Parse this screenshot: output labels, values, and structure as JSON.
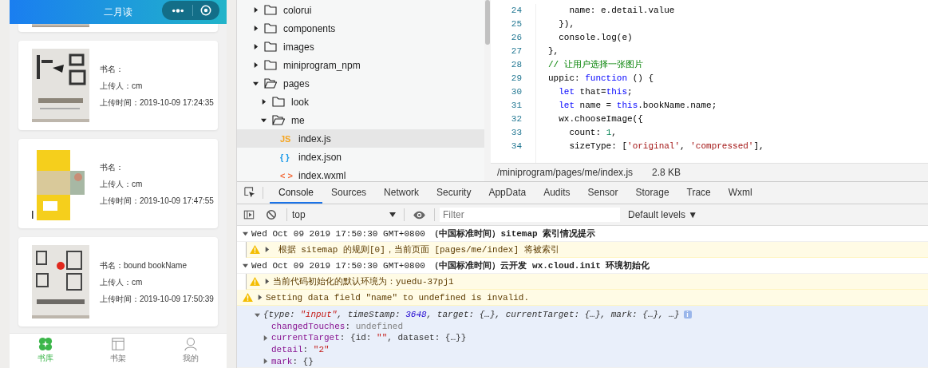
{
  "phone": {
    "title": "二月读",
    "books": [
      {
        "lines": [
          "书名：",
          "上传人：cm",
          "上传时间：2019-10-09 17:24:35"
        ]
      },
      {
        "lines": [
          "书名：",
          "上传人：cm",
          "上传时间：2019-10-09 17:47:55"
        ]
      },
      {
        "lines": [
          "书名：bound bookName",
          "上传人：cm",
          "上传时间：2019-10-09 17:50:39"
        ]
      }
    ],
    "tabbar": [
      {
        "label": "书库",
        "selected": true
      },
      {
        "label": "书架",
        "selected": false
      },
      {
        "label": "我的",
        "selected": false
      }
    ]
  },
  "tree": [
    {
      "name": "colorui",
      "kind": "folder",
      "expanded": false,
      "selected": false
    },
    {
      "name": "components",
      "kind": "folder",
      "expanded": false,
      "selected": false
    },
    {
      "name": "images",
      "kind": "folder",
      "expanded": false,
      "selected": false
    },
    {
      "name": "miniprogram_npm",
      "kind": "folder",
      "expanded": false,
      "selected": false
    },
    {
      "name": "pages",
      "kind": "folder",
      "expanded": true,
      "selected": false,
      "children": [
        {
          "name": "look",
          "kind": "folder",
          "expanded": false,
          "selected": false
        },
        {
          "name": "me",
          "kind": "folder",
          "expanded": true,
          "selected": false,
          "children": [
            {
              "name": "index.js",
              "kind": "file",
              "icon_text": "JS",
              "color": "#f5a623",
              "selected": true
            },
            {
              "name": "index.json",
              "kind": "file",
              "icon_text": "{ }",
              "color": "#1e9be9",
              "selected": false
            },
            {
              "name": "index.wxml",
              "kind": "file",
              "icon_text": "< >",
              "color": "#f26b3a",
              "selected": false
            }
          ]
        }
      ]
    }
  ],
  "editor": {
    "lines": [
      {
        "number": "24",
        "tokens": [
          {
            "text": "    name: e.detail.value",
            "kind": "plain"
          }
        ]
      },
      {
        "number": "25",
        "tokens": [
          {
            "text": "  }),",
            "kind": "plain"
          }
        ]
      },
      {
        "number": "26",
        "tokens": [
          {
            "text": "  console.log(e)",
            "kind": "plain"
          }
        ]
      },
      {
        "number": "27",
        "tokens": [
          {
            "text": "},",
            "kind": "plain"
          }
        ]
      },
      {
        "number": "28",
        "tokens": [
          {
            "text": "// 让用户选择一张图片",
            "kind": "comment"
          }
        ]
      },
      {
        "number": "29",
        "tokens": [
          {
            "text": "uppic: ",
            "kind": "plain"
          },
          {
            "text": "function",
            "kind": "keyword"
          },
          {
            "text": " () {",
            "kind": "plain"
          }
        ]
      },
      {
        "number": "30",
        "tokens": [
          {
            "text": "  let",
            "kind": "keyword"
          },
          {
            "text": " that=",
            "kind": "plain"
          },
          {
            "text": "this",
            "kind": "keyword"
          },
          {
            "text": ";",
            "kind": "plain"
          }
        ]
      },
      {
        "number": "31",
        "tokens": [
          {
            "text": "  let",
            "kind": "keyword"
          },
          {
            "text": " name = ",
            "kind": "plain"
          },
          {
            "text": "this",
            "kind": "keyword"
          },
          {
            "text": ".bookName.name;",
            "kind": "plain"
          }
        ]
      },
      {
        "number": "32",
        "tokens": [
          {
            "text": "  wx.chooseImage({",
            "kind": "plain"
          }
        ]
      },
      {
        "number": "33",
        "tokens": [
          {
            "text": "    count: ",
            "kind": "plain"
          },
          {
            "text": "1",
            "kind": "number"
          },
          {
            "text": ",",
            "kind": "plain"
          }
        ]
      },
      {
        "number": "34",
        "tokens": [
          {
            "text": "    sizeType: [",
            "kind": "plain"
          },
          {
            "text": "'original'",
            "kind": "string"
          },
          {
            "text": ", ",
            "kind": "plain"
          },
          {
            "text": "'compressed'",
            "kind": "string"
          },
          {
            "text": "],",
            "kind": "plain"
          }
        ]
      }
    ]
  },
  "status_bar": {
    "path": "/miniprogram/pages/me/index.js",
    "size": "2.8 KB"
  },
  "devtools": {
    "tabs": [
      {
        "label": "Console",
        "selected": true
      },
      {
        "label": "Sources",
        "selected": false
      },
      {
        "label": "Network",
        "selected": false
      },
      {
        "label": "Security",
        "selected": false
      },
      {
        "label": "AppData",
        "selected": false
      },
      {
        "label": "Audits",
        "selected": false
      },
      {
        "label": "Sensor",
        "selected": false
      },
      {
        "label": "Storage",
        "selected": false
      },
      {
        "label": "Trace",
        "selected": false
      },
      {
        "label": "Wxml",
        "selected": false
      }
    ],
    "context": "top",
    "filter": {
      "placeholder": "Filter"
    },
    "levels": {
      "label": "Default levels",
      "caret": "▼"
    },
    "messages": [
      {
        "kind": "group",
        "expanded": true,
        "text": "Wed Oct 09 2019 17:50:30 GMT+0800 **（中国标准时间）sitemap 索引情况提示**"
      },
      {
        "kind": "warning",
        "nested": true,
        "expanded": false,
        "text": " 根据 sitemap 的规则[0]，当前页面 [pages/me/index] 将被索引"
      },
      {
        "kind": "group",
        "expanded": true,
        "text": "Wed Oct 09 2019 17:50:30 GMT+0800 **（中国标准时间）云开发 wx.cloud.init 环境初始化**"
      },
      {
        "kind": "warning",
        "nested": true,
        "expanded": false,
        "text": "当前代码初始化的默认环境为：yuedu-37pj1"
      },
      {
        "kind": "warning",
        "nested": false,
        "expanded": false,
        "text": "Setting data field \"name\" to undefined is invalid."
      },
      {
        "kind": "object",
        "expanded": true,
        "summary": [
          {
            "text": "{type: ",
            "kind": "plain"
          },
          {
            "text": "\"input\"",
            "kind": "string"
          },
          {
            "text": ", timeStamp: ",
            "kind": "plain"
          },
          {
            "text": "3648",
            "kind": "number"
          },
          {
            "text": ", target: {…}, currentTarget: {…}, mark: {…}, …}",
            "kind": "plain"
          }
        ],
        "info": "i",
        "properties": [
          {
            "expandable": false,
            "tokens": [
              {
                "text": "changedTouches",
                "kind": "key"
              },
              {
                "text": ": ",
                "kind": "plain"
              },
              {
                "text": "undefined",
                "kind": "null"
              }
            ]
          },
          {
            "expandable": true,
            "tokens": [
              {
                "text": "currentTarget",
                "kind": "key"
              },
              {
                "text": ": {id: ",
                "kind": "plain"
              },
              {
                "text": "\"\"",
                "kind": "string"
              },
              {
                "text": ", dataset: {…}}",
                "kind": "plain"
              }
            ]
          },
          {
            "expandable": false,
            "tokens": [
              {
                "text": "detail",
                "kind": "key"
              },
              {
                "text": ": ",
                "kind": "plain"
              },
              {
                "text": "\"2\"",
                "kind": "string"
              }
            ]
          },
          {
            "expandable": true,
            "tokens": [
              {
                "text": "mark",
                "kind": "key"
              },
              {
                "text": ": {}",
                "kind": "plain"
              }
            ]
          }
        ]
      }
    ]
  }
}
